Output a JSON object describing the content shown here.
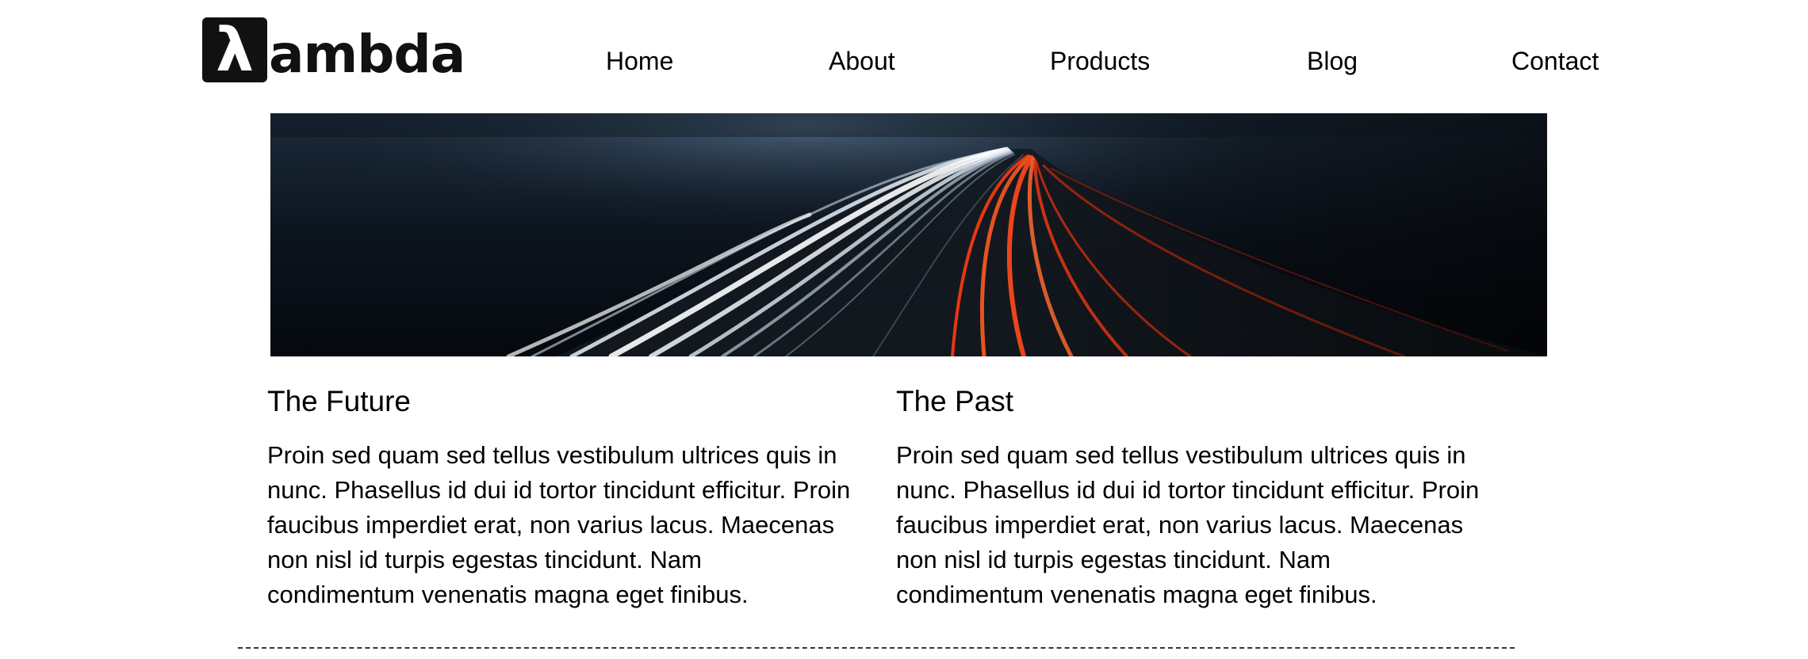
{
  "header": {
    "logo": {
      "mark": "λ",
      "text": "ambda"
    },
    "nav": {
      "home": "Home",
      "about": "About",
      "products": "Products",
      "blog": "Blog",
      "contact": "Contact"
    }
  },
  "hero": {
    "image": "highway-light-trails-night-image"
  },
  "columns": [
    {
      "title": "The Future",
      "body": "Proin sed quam sed tellus vestibulum ultrices quis in nunc. Phasellus id dui id tortor tincidunt efficitur. Proin faucibus imperdiet erat, non varius lacus. Maecenas non nisl id turpis egestas tincidunt. Nam condimentum venenatis magna eget finibus."
    },
    {
      "title": "The Past",
      "body": "Proin sed quam sed tellus vestibulum ultrices quis in nunc. Phasellus id dui id tortor tincidunt efficitur. Proin faucibus imperdiet erat, non varius lacus. Maecenas non nisl id turpis egestas tincidunt. Nam condimentum venenatis magna eget finibus."
    }
  ],
  "colors": {
    "text": "#000000",
    "logo": "#111111",
    "background": "#ffffff",
    "trail_white": "#e8f0f8",
    "trail_red": "#ff4a1c"
  }
}
